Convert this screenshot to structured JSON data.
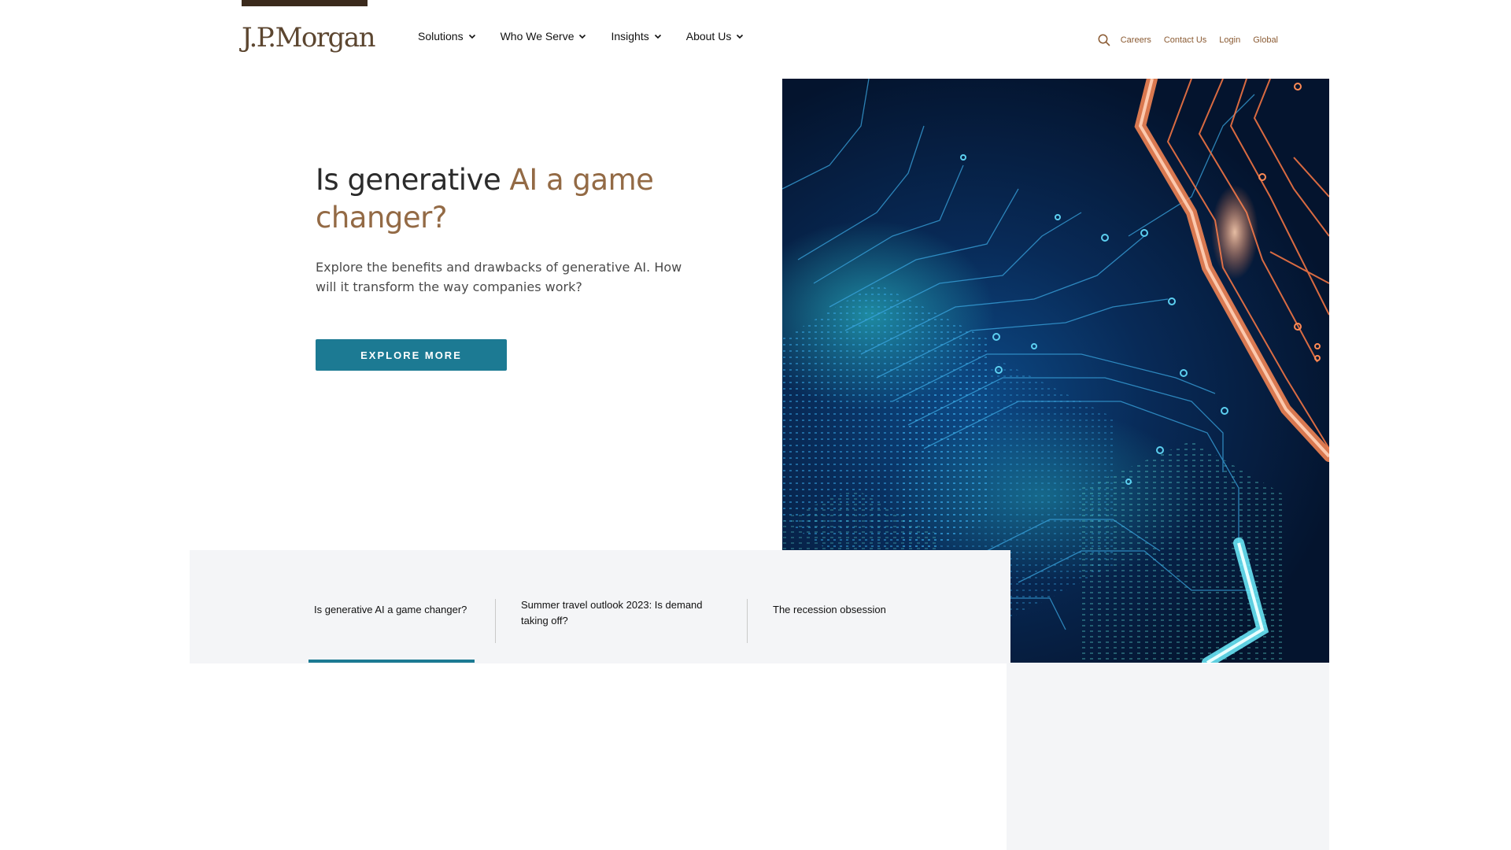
{
  "header": {
    "logo": "J.P.Morgan",
    "nav": [
      {
        "label": "Solutions"
      },
      {
        "label": "Who We Serve"
      },
      {
        "label": "Insights"
      },
      {
        "label": "About Us"
      }
    ],
    "utility_links": [
      {
        "label": "Careers"
      },
      {
        "label": "Contact Us"
      },
      {
        "label": "Login"
      },
      {
        "label": "Global"
      }
    ]
  },
  "hero": {
    "title_plain": "Is generative ",
    "title_accent": "AI a game changer?",
    "description": "Explore the benefits and drawbacks of generative AI. How will it transform the way companies work?",
    "cta_label": "EXPLORE MORE"
  },
  "tabs": [
    {
      "label": "Is generative AI a game changer?",
      "active": true
    },
    {
      "label": "Summer travel outlook 2023: Is demand taking off?",
      "active": false
    },
    {
      "label": "The recession obsession",
      "active": false
    }
  ],
  "colors": {
    "brand_brown": "#8a5a32",
    "accent_teal": "#1c7a93",
    "panel_bg": "#f4f5f7"
  }
}
